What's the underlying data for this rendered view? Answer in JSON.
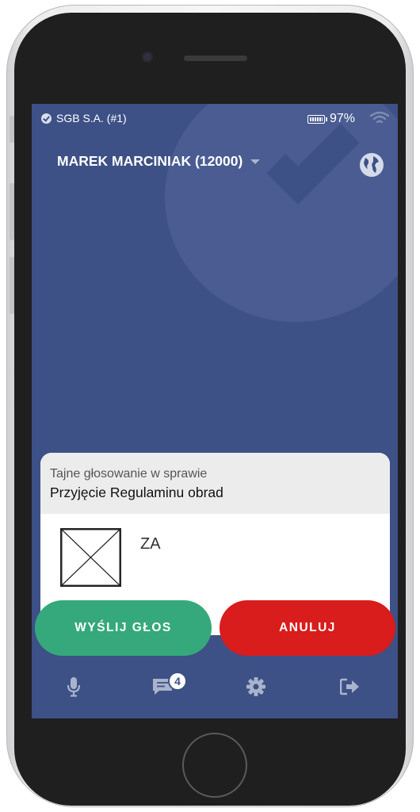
{
  "status_bar": {
    "carrier": "SGB S.A. (#1)",
    "battery_percent": "97%"
  },
  "header": {
    "user_name": "MAREK MARCINIAK (12000)"
  },
  "vote": {
    "subtitle": "Tajne głosowanie w sprawie",
    "title": "Przyjęcie Regulaminu obrad",
    "option_label": "ZA",
    "option_checked": false
  },
  "actions": {
    "send_label": "WYŚLIJ GŁOS",
    "cancel_label": "ANULUJ"
  },
  "bottom_nav": {
    "messages_badge": "4",
    "items": [
      "microphone-icon",
      "messages-icon",
      "gear-icon",
      "logout-icon"
    ]
  },
  "colors": {
    "background": "#3d5186",
    "send_button": "#35a97b",
    "cancel_button": "#d91c1c"
  }
}
